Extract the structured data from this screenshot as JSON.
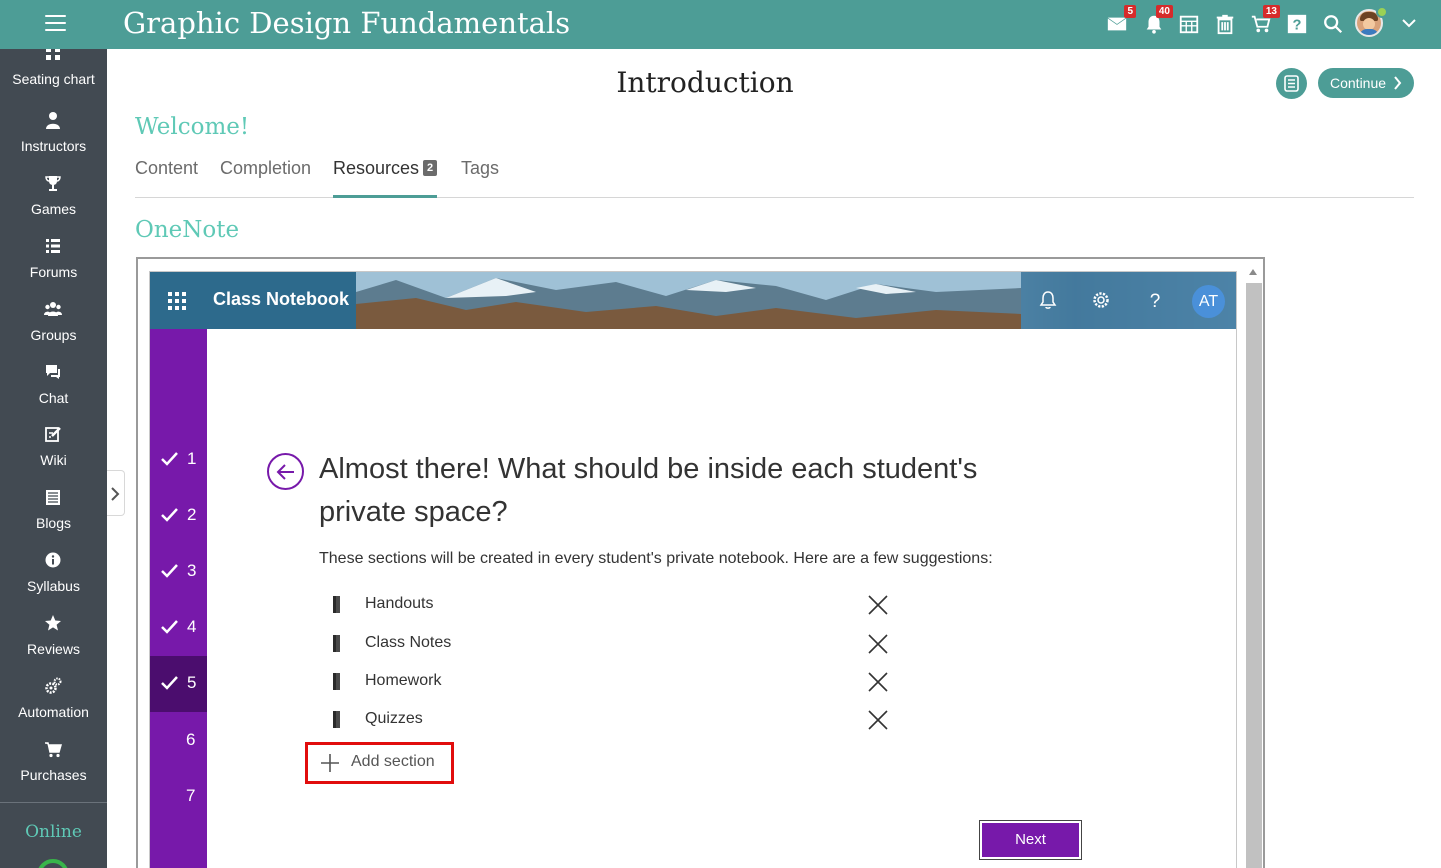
{
  "topbar": {
    "title": "Graphic Design Fundamentals",
    "badges": {
      "messages": "5",
      "notifications": "40",
      "cart": "13"
    }
  },
  "sidebar": {
    "items": [
      {
        "label": "Seating chart",
        "icon": "seating-chart-icon"
      },
      {
        "label": "Instructors",
        "icon": "instructor-icon"
      },
      {
        "label": "Games",
        "icon": "trophy-icon"
      },
      {
        "label": "Forums",
        "icon": "forum-icon"
      },
      {
        "label": "Groups",
        "icon": "groups-icon"
      },
      {
        "label": "Chat",
        "icon": "chat-icon"
      },
      {
        "label": "Wiki",
        "icon": "wiki-icon"
      },
      {
        "label": "Blogs",
        "icon": "blog-icon"
      },
      {
        "label": "Syllabus",
        "icon": "info-icon"
      },
      {
        "label": "Reviews",
        "icon": "star-icon"
      },
      {
        "label": "Automation",
        "icon": "gears-icon"
      },
      {
        "label": "Purchases",
        "icon": "cart-icon"
      }
    ],
    "online_label": "Online"
  },
  "main": {
    "page_title": "Introduction",
    "continue_label": "Continue",
    "unit_title": "Welcome!",
    "tabs": [
      {
        "label": "Content"
      },
      {
        "label": "Completion"
      },
      {
        "label": "Resources",
        "count": "2"
      },
      {
        "label": "Tags"
      }
    ],
    "active_tab": "Resources",
    "resource_heading": "OneNote"
  },
  "onenote": {
    "app_title": "Class Notebook",
    "user_initials": "AT",
    "steps": [
      "1",
      "2",
      "3",
      "4",
      "5",
      "6",
      "7"
    ],
    "completed_steps": 5,
    "current_step": 5,
    "heading": "Almost there! What should be inside each student's private space?",
    "description": "These sections will be created in every student's private notebook. Here are a few suggestions:",
    "sections": [
      "Handouts",
      "Class Notes",
      "Homework",
      "Quizzes"
    ],
    "add_section_label": "Add section",
    "next_label": "Next"
  },
  "colors": {
    "topbar": "#4d9d96",
    "sidebar": "#424a52",
    "accent_teal": "#5fc9b6",
    "onenote_purple": "#7719aa",
    "highlight_red": "#e10d0d"
  }
}
